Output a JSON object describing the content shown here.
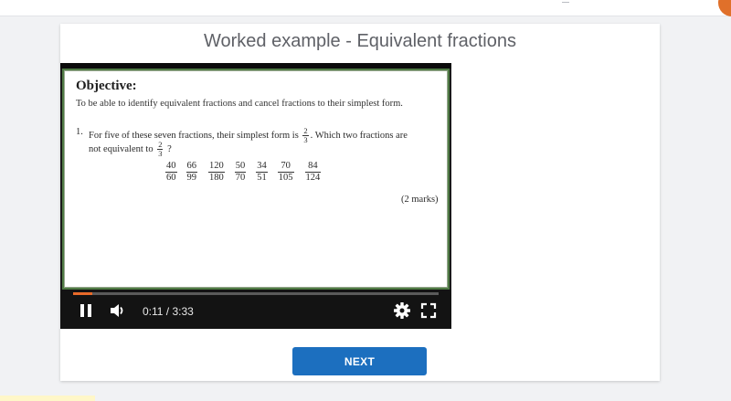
{
  "page": {
    "title": "Worked example - Equivalent fractions"
  },
  "video": {
    "objective_heading": "Objective:",
    "objective_text": "To be able to identify equivalent fractions and cancel fractions to their simplest form.",
    "question_number": "1.",
    "question_line1_before": "For five of these seven fractions, their simplest form is",
    "question_line1_after": ". Which two fractions are",
    "question_line2_before": "not equivalent to",
    "question_line2_after": "?",
    "target_fraction": {
      "num": "2",
      "den": "3"
    },
    "fractions": [
      {
        "num": "40",
        "den": "60"
      },
      {
        "num": "66",
        "den": "99"
      },
      {
        "num": "120",
        "den": "180"
      },
      {
        "num": "50",
        "den": "70"
      },
      {
        "num": "34",
        "den": "51"
      },
      {
        "num": "70",
        "den": "105"
      },
      {
        "num": "84",
        "den": "124"
      }
    ],
    "marks": "(2 marks)",
    "time_display": "0:11 / 3:33",
    "progress_fraction": 0.052,
    "accent_color": "#e86a2a",
    "icons": {
      "pause": "pause-icon",
      "volume": "volume-icon",
      "settings": "gear-icon",
      "fullscreen": "fullscreen-icon"
    }
  },
  "actions": {
    "next_label": "NEXT",
    "next_color": "#1c6fbf"
  }
}
